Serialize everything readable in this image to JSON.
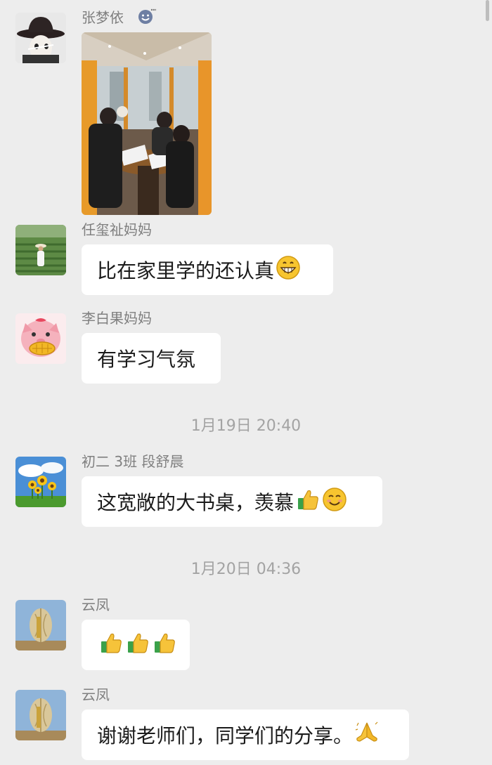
{
  "messages": [
    {
      "sender": "张梦依",
      "type": "image",
      "avatar_icon": "cowboy-hat-avatar",
      "status_icon": "smiley-status-icon"
    },
    {
      "sender": "任玺祉妈妈",
      "type": "text",
      "text": "比在家里学的还认真",
      "emoji": [
        "grinning-face"
      ]
    },
    {
      "sender": "李白果妈妈",
      "type": "text",
      "text": "有学习气氛",
      "emoji": []
    },
    {
      "sender": "初二 3班 段舒晨",
      "type": "text",
      "text": "这宽敞的大书桌，羡慕",
      "emoji": [
        "thumbs-up",
        "smiling-face"
      ]
    },
    {
      "sender": "云凤",
      "type": "text",
      "text": "",
      "emoji": [
        "thumbs-up",
        "thumbs-up",
        "thumbs-up"
      ]
    },
    {
      "sender": "云凤",
      "type": "text",
      "text": "谢谢老师们，同学们的分享。",
      "emoji": [
        "folded-hands"
      ]
    }
  ],
  "timestamps": [
    "1月19日 20:40",
    "1月20日 04:36"
  ],
  "colors": {
    "background": "#ededed",
    "bubble": "#ffffff",
    "name": "#7f7f7f",
    "timestamp": "#a3a3a3"
  }
}
